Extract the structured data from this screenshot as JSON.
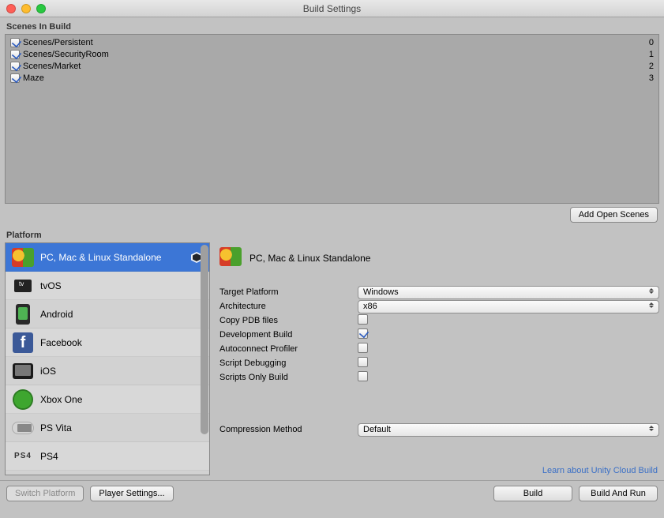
{
  "window": {
    "title": "Build Settings"
  },
  "scenes_header": "Scenes In Build",
  "scenes": [
    {
      "name": "Scenes/Persistent",
      "index": 0,
      "checked": true
    },
    {
      "name": "Scenes/SecurityRoom",
      "index": 1,
      "checked": true
    },
    {
      "name": "Scenes/Market",
      "index": 2,
      "checked": true
    },
    {
      "name": "Maze",
      "index": 3,
      "checked": true
    }
  ],
  "add_open_scenes_label": "Add Open Scenes",
  "platform_header": "Platform",
  "platforms": [
    {
      "id": "standalone",
      "label": "PC, Mac & Linux Standalone",
      "icon": "pc-icon",
      "selected": true,
      "current": true
    },
    {
      "id": "tvos",
      "label": "tvOS",
      "icon": "appletv-icon"
    },
    {
      "id": "android",
      "label": "Android",
      "icon": "android-icon"
    },
    {
      "id": "facebook",
      "label": "Facebook",
      "icon": "facebook-icon"
    },
    {
      "id": "ios",
      "label": "iOS",
      "icon": "ios-icon"
    },
    {
      "id": "xboxone",
      "label": "Xbox One",
      "icon": "xbox-icon"
    },
    {
      "id": "psvita",
      "label": "PS Vita",
      "icon": "psvita-icon"
    },
    {
      "id": "ps4",
      "label": "PS4",
      "icon": "ps4-icon"
    },
    {
      "id": "html",
      "label": "",
      "icon": "html-icon"
    }
  ],
  "detail": {
    "title": "PC, Mac & Linux Standalone",
    "target_platform": {
      "label": "Target Platform",
      "value": "Windows"
    },
    "architecture": {
      "label": "Architecture",
      "value": "x86"
    },
    "copy_pdb": {
      "label": "Copy PDB files",
      "checked": false
    },
    "dev_build": {
      "label": "Development Build",
      "checked": true
    },
    "autoconnect": {
      "label": "Autoconnect Profiler",
      "checked": false
    },
    "script_debug": {
      "label": "Script Debugging",
      "checked": false
    },
    "scripts_only": {
      "label": "Scripts Only Build",
      "checked": false
    },
    "compression": {
      "label": "Compression Method",
      "value": "Default"
    }
  },
  "cloud_link": "Learn about Unity Cloud Build",
  "buttons": {
    "switch_platform": "Switch Platform",
    "player_settings": "Player Settings...",
    "build": "Build",
    "build_and_run": "Build And Run"
  }
}
